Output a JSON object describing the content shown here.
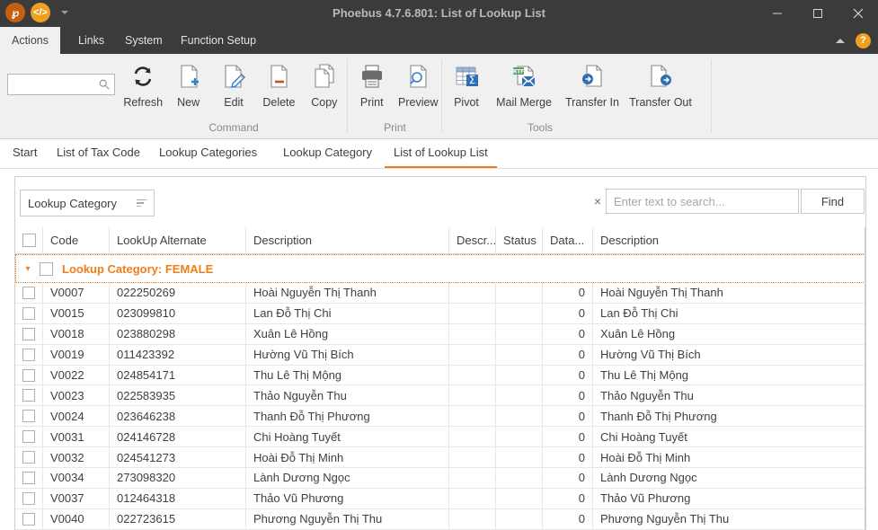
{
  "window": {
    "title": "Phoebus 4.7.6.801: List of Lookup List",
    "quick_access": [
      {
        "name": "phoebus-logo-icon",
        "glyph": "℘"
      },
      {
        "name": "code-icon",
        "glyph": "</>"
      }
    ],
    "controls": {
      "minimize": "–",
      "maximize": "□",
      "close": "✕"
    }
  },
  "ribbon_tabs": {
    "items": [
      {
        "label": "Actions",
        "active": true
      },
      {
        "label": "Links",
        "active": false
      },
      {
        "label": "System",
        "active": false
      },
      {
        "label": "Function Setup",
        "active": false
      }
    ],
    "collapse_label": "",
    "help_label": "?"
  },
  "ribbon": {
    "search": {
      "value": "",
      "placeholder": ""
    },
    "groups": [
      {
        "label": "Command",
        "commands": [
          {
            "label": "Refresh",
            "icon": "refresh-icon"
          },
          {
            "label": "New",
            "icon": "new-document-icon"
          },
          {
            "label": "Edit",
            "icon": "edit-pencil-icon"
          },
          {
            "label": "Delete",
            "icon": "delete-document-icon"
          },
          {
            "label": "Copy",
            "icon": "copy-icon"
          }
        ]
      },
      {
        "label": "Print",
        "commands": [
          {
            "label": "Print",
            "icon": "printer-icon"
          },
          {
            "label": "Preview",
            "icon": "print-preview-icon"
          }
        ]
      },
      {
        "label": "Tools",
        "commands": [
          {
            "label": "Pivot",
            "icon": "pivot-table-icon"
          },
          {
            "label": "Mail Merge",
            "icon": "mail-merge-icon"
          },
          {
            "label": "Transfer In",
            "icon": "transfer-in-icon"
          },
          {
            "label": "Transfer Out",
            "icon": "transfer-out-icon"
          }
        ]
      }
    ]
  },
  "document_tabs": [
    {
      "label": "Start",
      "active": false
    },
    {
      "label": "List of Tax Code",
      "active": false
    },
    {
      "label": "Lookup Categories",
      "active": false
    },
    {
      "label": "Lookup Category",
      "active": false
    },
    {
      "label": "List of Lookup List",
      "active": true
    }
  ],
  "filter_bar": {
    "category_chip": "Lookup Category",
    "clear_icon": "×",
    "search": {
      "value": "",
      "placeholder": "Enter text to search..."
    },
    "find_label": "Find"
  },
  "grid": {
    "columns": [
      {
        "key": "check",
        "label": ""
      },
      {
        "key": "code",
        "label": "Code"
      },
      {
        "key": "alt",
        "label": "LookUp Alternate"
      },
      {
        "key": "desc",
        "label": "Description"
      },
      {
        "key": "desc_trunc",
        "label": "Descr..."
      },
      {
        "key": "status",
        "label": "Status"
      },
      {
        "key": "data_trunc",
        "label": "Data..."
      },
      {
        "key": "desc2",
        "label": "Description"
      }
    ],
    "group": {
      "caret": "▾",
      "label": "Lookup Category: FEMALE",
      "accent": "#f07d1a"
    },
    "rows": [
      {
        "code": "V0007",
        "alt": "022250269",
        "desc": "Hoài  Nguyễn Thị Thanh",
        "desc_trunc": "",
        "status": "",
        "data_trunc": "0",
        "desc2": "Hoài  Nguyễn Thị Thanh"
      },
      {
        "code": "V0015",
        "alt": "023099810",
        "desc": "Lan  Đỗ Thị Chi",
        "desc_trunc": "",
        "status": "",
        "data_trunc": "0",
        "desc2": "Lan  Đỗ Thị Chi"
      },
      {
        "code": "V0018",
        "alt": "023880298",
        "desc": "Xuân  Lê Hồng",
        "desc_trunc": "",
        "status": "",
        "data_trunc": "0",
        "desc2": "Xuân  Lê Hồng"
      },
      {
        "code": "V0019",
        "alt": "011423392",
        "desc": "Hường  Vũ Thị Bích",
        "desc_trunc": "",
        "status": "",
        "data_trunc": "0",
        "desc2": "Hường  Vũ Thị Bích"
      },
      {
        "code": "V0022",
        "alt": "024854171",
        "desc": "Thu  Lê Thị Mộng",
        "desc_trunc": "",
        "status": "",
        "data_trunc": "0",
        "desc2": "Thu  Lê Thị Mộng"
      },
      {
        "code": "V0023",
        "alt": "022583935",
        "desc": "Thảo  Nguyễn Thu",
        "desc_trunc": "",
        "status": "",
        "data_trunc": "0",
        "desc2": "Thảo  Nguyễn Thu"
      },
      {
        "code": "V0024",
        "alt": "023646238",
        "desc": "Thanh  Đỗ Thị Phương",
        "desc_trunc": "",
        "status": "",
        "data_trunc": "0",
        "desc2": "Thanh  Đỗ Thị Phương"
      },
      {
        "code": "V0031",
        "alt": "024146728",
        "desc": "Chi  Hoàng Tuyết",
        "desc_trunc": "",
        "status": "",
        "data_trunc": "0",
        "desc2": "Chi  Hoàng Tuyết"
      },
      {
        "code": "V0032",
        "alt": "024541273",
        "desc": "Hoài  Đỗ Thị Minh",
        "desc_trunc": "",
        "status": "",
        "data_trunc": "0",
        "desc2": "Hoài  Đỗ Thị Minh"
      },
      {
        "code": "V0034",
        "alt": "273098320",
        "desc": "Lành  Dương Ngọc",
        "desc_trunc": "",
        "status": "",
        "data_trunc": "0",
        "desc2": "Lành  Dương Ngọc"
      },
      {
        "code": "V0037",
        "alt": "012464318",
        "desc": "Thảo  Vũ Phương",
        "desc_trunc": "",
        "status": "",
        "data_trunc": "0",
        "desc2": "Thảo  Vũ Phương"
      },
      {
        "code": "V0040",
        "alt": "022723615",
        "desc": "Phương  Nguyễn Thị Thu",
        "desc_trunc": "",
        "status": "",
        "data_trunc": "0",
        "desc2": "Phương  Nguyễn Thị Thu"
      }
    ]
  },
  "colors": {
    "accent": "#f07d1a",
    "titlebar": "#3b3b3b",
    "ribbon": "#f0f0f0"
  }
}
